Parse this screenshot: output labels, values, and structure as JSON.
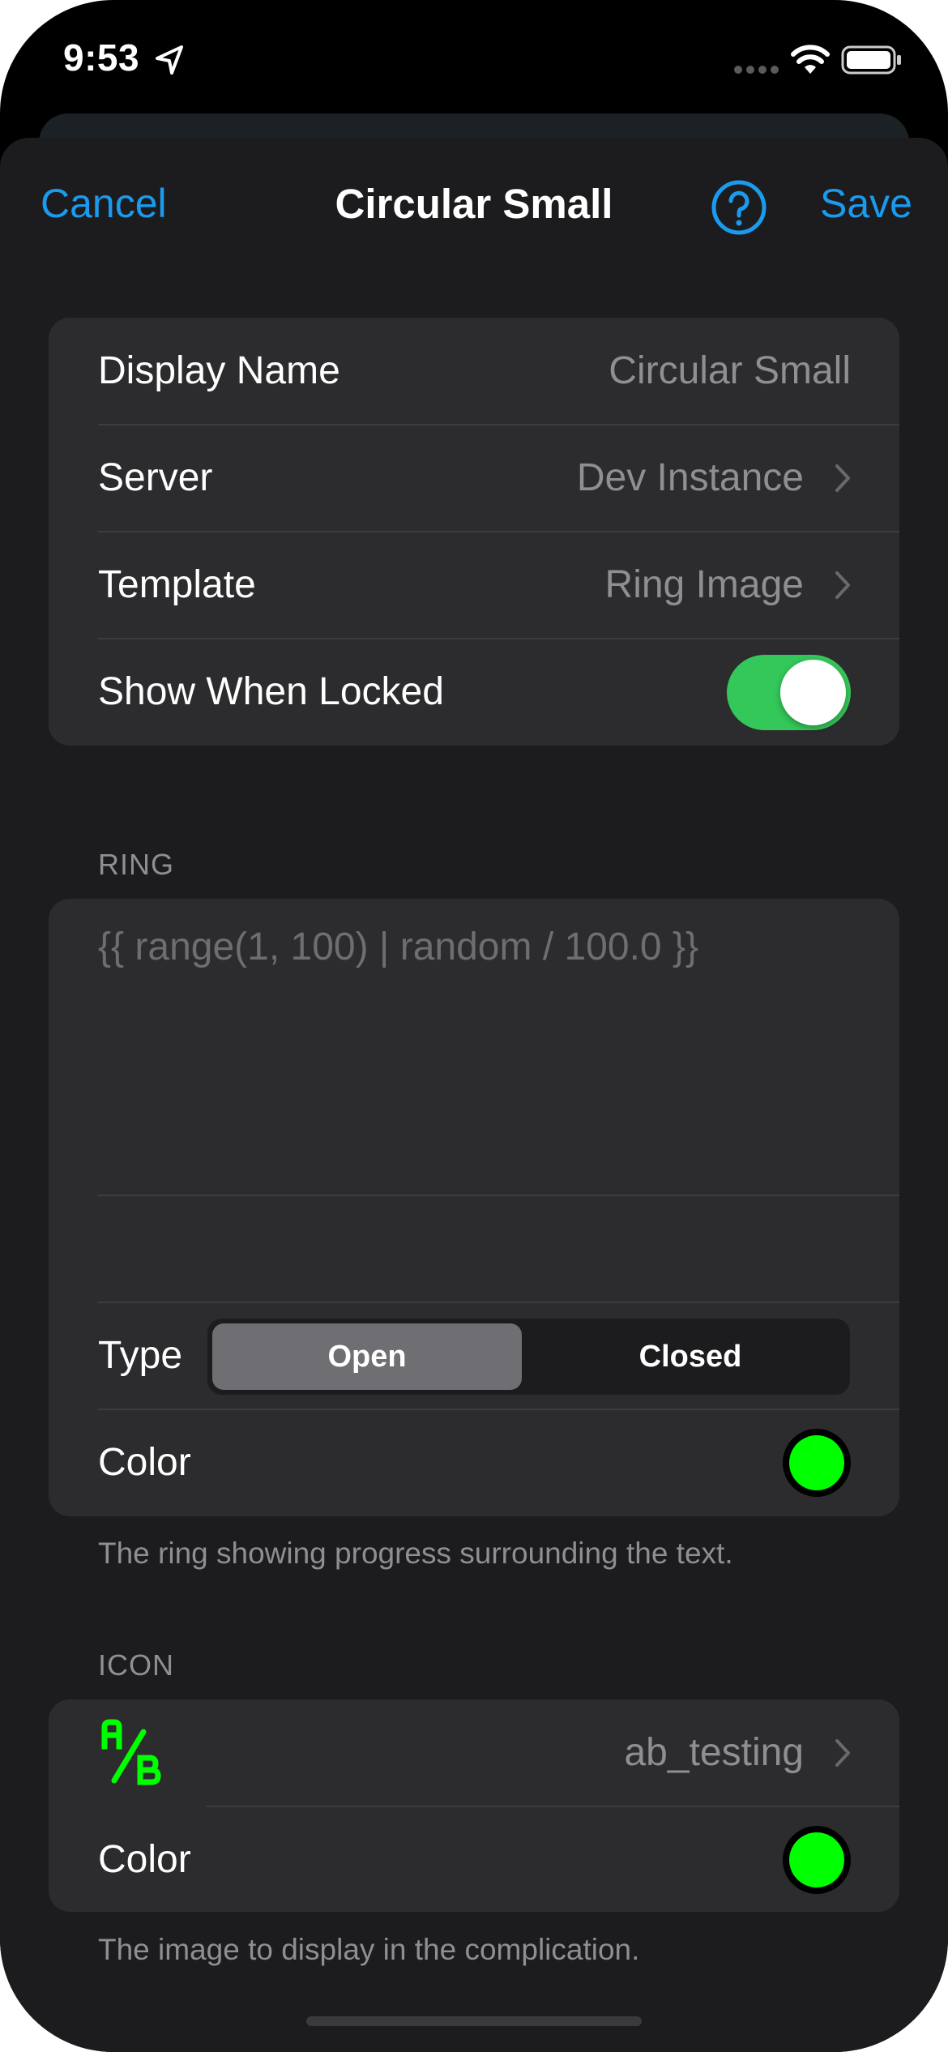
{
  "status_bar": {
    "time": "9:53"
  },
  "nav": {
    "cancel_label": "Cancel",
    "title": "Circular Small",
    "save_label": "Save"
  },
  "general": {
    "display_name_label": "Display Name",
    "display_name_placeholder": "Circular Small",
    "server_label": "Server",
    "server_value": "Dev Instance",
    "template_label": "Template",
    "template_value": "Ring Image",
    "show_locked_label": "Show When Locked",
    "show_locked_on": true
  },
  "ring": {
    "header": "RING",
    "template_text": "{{ range(1, 100) | random / 100.0 }}",
    "type_label": "Type",
    "type_options": [
      "Open",
      "Closed"
    ],
    "type_selected": "Open",
    "color_label": "Color",
    "color_value": "#00ff00",
    "footer": "The ring showing progress surrounding the text."
  },
  "icon": {
    "header": "ICON",
    "icon_name": "ab_testing",
    "color_label": "Color",
    "color_value": "#00ff00",
    "footer": "The image to display in the complication."
  },
  "colors": {
    "accent": "#1a9bee",
    "toggle_on": "#34c759",
    "background": "#1c1c1e",
    "cell": "#2c2c2e"
  }
}
